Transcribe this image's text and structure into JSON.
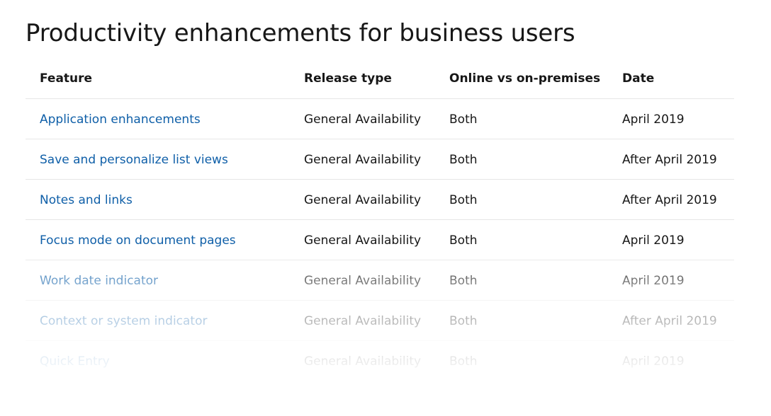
{
  "page": {
    "title": "Productivity enhancements for business users"
  },
  "table": {
    "headers": [
      "Feature",
      "Release type",
      "Online vs on-premises",
      "Date"
    ],
    "rows": [
      {
        "feature": "Application enhancements",
        "release": "General Availability",
        "deployment": "Both",
        "date": "April 2019"
      },
      {
        "feature": "Save and personalize list views",
        "release": "General Availability",
        "deployment": "Both",
        "date": "After April 2019"
      },
      {
        "feature": "Notes and links",
        "release": "General Availability",
        "deployment": "Both",
        "date": "After April 2019"
      },
      {
        "feature": "Focus mode on document pages",
        "release": "General Availability",
        "deployment": "Both",
        "date": "April 2019"
      },
      {
        "feature": "Work date indicator",
        "release": "General Availability",
        "deployment": "Both",
        "date": "April 2019"
      },
      {
        "feature": "Context or system indicator",
        "release": "General Availability",
        "deployment": "Both",
        "date": "After April 2019"
      },
      {
        "feature": "Quick Entry",
        "release": "General Availability",
        "deployment": "Both",
        "date": "April 2019"
      }
    ]
  },
  "colors": {
    "link": "#0f5fa8",
    "text": "#171717",
    "divider": "#e6e6e6"
  }
}
